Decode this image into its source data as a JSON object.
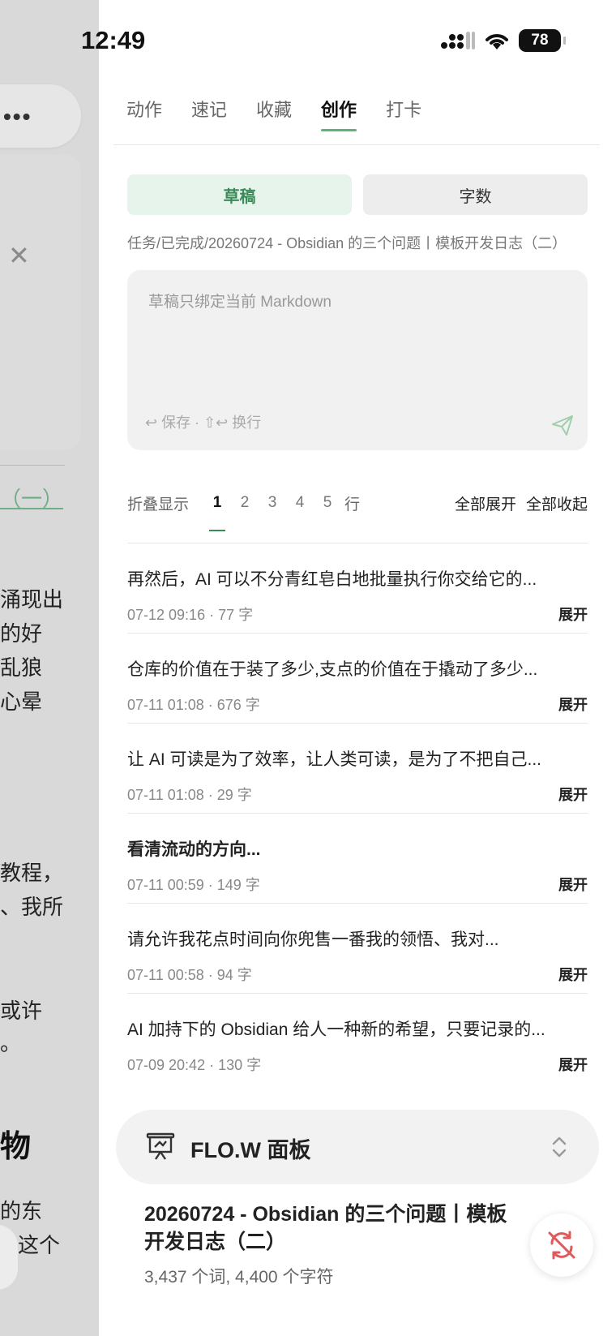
{
  "status_bar": {
    "time": "12:49",
    "battery": "78"
  },
  "left_layer": {
    "link_text": "（一）",
    "text_lines_1": [
      "涌现出",
      "的好",
      "乱狼",
      "心晕"
    ],
    "text_lines_2": [
      "教程，",
      "、我所"
    ],
    "text_lines_3": [
      "或许",
      "。"
    ],
    "bold_char": "物",
    "text_lines_4": [
      "的东",
      "这个"
    ]
  },
  "tabs": [
    {
      "label": "动作",
      "active": false
    },
    {
      "label": "速记",
      "active": false
    },
    {
      "label": "收藏",
      "active": false
    },
    {
      "label": "创作",
      "active": true
    },
    {
      "label": "打卡",
      "active": false
    }
  ],
  "segment": {
    "draft_label": "草稿",
    "wordcount_label": "字数"
  },
  "path": "任务/已完成/20260724 - Obsidian 的三个问题丨模板开发日志（二）",
  "input": {
    "placeholder": "草稿只绑定当前 Markdown",
    "hint": "↩ 保存 · ⇧↩ 换行"
  },
  "fold": {
    "label": "折叠显示",
    "numbers": [
      "1",
      "2",
      "3",
      "4",
      "5"
    ],
    "active_index": 0,
    "unit": "行",
    "expand_all": "全部展开",
    "collapse_all": "全部收起"
  },
  "entries": [
    {
      "title": "再然后，AI 可以不分青红皂白地批量执行你交给它的...",
      "meta": "07-12 09:16 · 77 字",
      "expand": "展开",
      "bold": false
    },
    {
      "title": "仓库的价值在于装了多少,支点的价值在于撬动了多少...",
      "meta": "07-11 01:08 · 676 字",
      "expand": "展开",
      "bold": false
    },
    {
      "title": "让 AI 可读是为了效率，让人类可读，是为了不把自己...",
      "meta": "07-11 01:08 · 29 字",
      "expand": "展开",
      "bold": false
    },
    {
      "title": "看清流动的方向...",
      "meta": "07-11 00:59 · 149 字",
      "expand": "展开",
      "bold": true
    },
    {
      "title": "请允许我花点时间向你兜售一番我的领悟、我对...",
      "meta": "07-11 00:58 · 94 字",
      "expand": "展开",
      "bold": false
    },
    {
      "title": "AI 加持下的 Obsidian 给人一种新的希望，只要记录的...",
      "meta": "07-09 20:42 · 130 字",
      "expand": "展开",
      "bold": false
    }
  ],
  "flow_panel": {
    "title": "FLO.W 面板"
  },
  "document": {
    "title": "20260724 - Obsidian 的三个问题丨模板开发日志（二）",
    "stats": "3,437 个词, 4,400 个字符"
  },
  "colors": {
    "accent": "#5cb37c",
    "sync_red": "#e05a5a"
  },
  "icons": [
    "signal-icon",
    "wifi-icon",
    "send-icon",
    "presentation-board-icon",
    "chevron-updown-icon",
    "sync-off-icon",
    "close-icon",
    "more-icon"
  ]
}
